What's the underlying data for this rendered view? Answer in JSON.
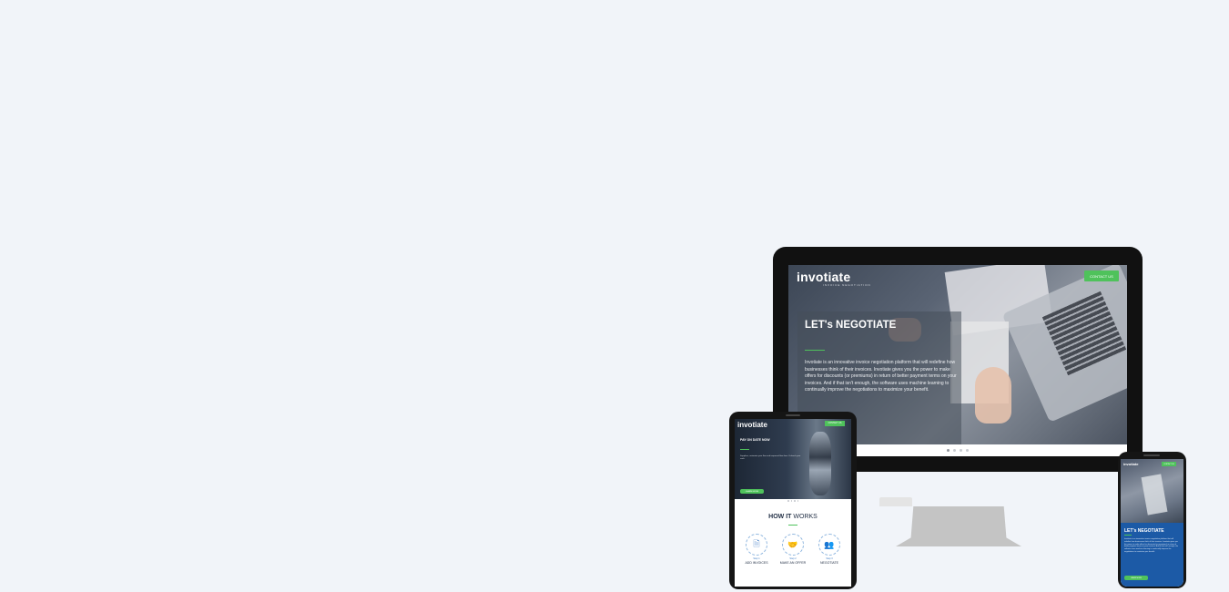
{
  "desktop": {
    "logo": "invotiate",
    "logo_tagline": "INVOICE NEGOTIATION",
    "contact_button": "CONTACT US",
    "hero_title": "LET's NEGOTIATE",
    "hero_description": "Invotiate is an innovative invoice negotiation platform that will redefine how businesses think of their invoices. Invotiate gives you the power to make offers for discounts (or premiums) in return of better payment terms on your invoices. And if that isn't enough, the software uses machine learning to continually improve the negotiations to maximize your benefit.",
    "carousel_dots": 4,
    "active_dot": 0
  },
  "tablet": {
    "logo": "invotiate",
    "contact_button": "CONTACT US",
    "hero_title": "PAY ON DATE NOW",
    "hero_description": "Suppliers, automate your flow and improved flow fixes. Unleash your cash.",
    "hero_cta": "LEARN MORE",
    "how_prefix": "HOW IT",
    "how_suffix": "WORKS",
    "steps": [
      {
        "num": "Step 1",
        "label": "ADD INVOICES",
        "icon": "document-icon",
        "glyph": "🗎"
      },
      {
        "num": "Step 2",
        "label": "MAKE AN OFFER",
        "icon": "handshake-icon",
        "glyph": "🤝"
      },
      {
        "num": "Step 3",
        "label": "NEGOTIATE",
        "icon": "people-icon",
        "glyph": "👥"
      }
    ]
  },
  "phone": {
    "logo": "invotiate",
    "contact_button": "CONTACT US",
    "panel_title": "LET's NEGOTIATE",
    "panel_description": "Invotiate is an innovative invoice negotiation platform that will redefine how businesses think of their invoices. Invotiate gives you the power to make offers for discounts (or premiums) in return of better payment terms on your invoices. And if that isn't enough, the software uses machine learning to continually improve the negotiations to maximize your benefit.",
    "panel_cta": "LEARN MORE"
  },
  "colors": {
    "accent": "#4fc25b",
    "phone_panel": "#1c5aa6",
    "background": "#f1f4f9"
  }
}
